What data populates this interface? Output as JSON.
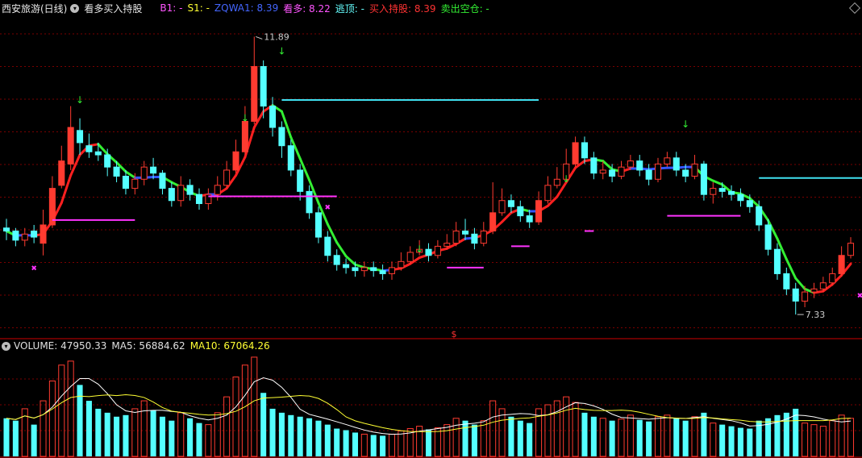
{
  "header": {
    "stock_name": "西安旅游(日线)",
    "indicator_name": "看多买入持股",
    "b1": "B1: -",
    "s1": "S1: -",
    "zqwa1": "ZQWA1: 8.39",
    "kanduo": "看多: 8.22",
    "taoding": "逃顶: -",
    "mairu": "买入持股: 8.39",
    "maichu": "卖出空仓: -"
  },
  "volume_header": {
    "volume": "VOLUME: 47950.33",
    "ma5": "MA5: 56884.62",
    "ma10": "MA10: 67064.26"
  },
  "annotations": {
    "high": "11.89",
    "low": "7.33",
    "marker": "$"
  },
  "colors": {
    "up": "#ff3b30",
    "down": "#54ffff",
    "ma_up": "#ff2020",
    "ma_down": "#33ee33",
    "ma_flat": "#3355ff",
    "magenta": "#ff33ff",
    "cyan": "#40e0f0",
    "grid": "#7a0000",
    "yellow": "#ffff33",
    "white": "#ffffff"
  },
  "chart_data": {
    "type": "candlestick",
    "ylim": [
      7.0,
      12.2
    ],
    "volume_ylim": [
      0,
      130000
    ],
    "candles": [
      [
        8.75,
        8.7,
        8.9,
        8.55,
        48000
      ],
      [
        8.7,
        8.55,
        8.75,
        8.45,
        45000
      ],
      [
        8.55,
        8.65,
        8.75,
        8.45,
        60000
      ],
      [
        8.7,
        8.6,
        8.8,
        8.5,
        40000
      ],
      [
        8.5,
        8.8,
        9.05,
        8.3,
        70000
      ],
      [
        8.8,
        9.4,
        9.6,
        8.75,
        95000
      ],
      [
        9.45,
        9.85,
        10.1,
        9.4,
        115000
      ],
      [
        9.8,
        10.4,
        10.75,
        9.7,
        120000
      ],
      [
        10.35,
        10.15,
        10.55,
        9.95,
        90000
      ],
      [
        10.1,
        10.0,
        10.3,
        9.9,
        70000
      ],
      [
        10.0,
        9.95,
        10.15,
        9.85,
        60000
      ],
      [
        9.95,
        9.75,
        10.05,
        9.6,
        55000
      ],
      [
        9.75,
        9.6,
        9.85,
        9.5,
        50000
      ],
      [
        9.6,
        9.4,
        9.7,
        9.3,
        52000
      ],
      [
        9.4,
        9.55,
        9.65,
        9.3,
        60000
      ],
      [
        9.55,
        9.75,
        9.85,
        9.45,
        70000
      ],
      [
        9.75,
        9.65,
        9.9,
        9.55,
        58000
      ],
      [
        9.65,
        9.4,
        9.7,
        9.3,
        50000
      ],
      [
        9.4,
        9.2,
        9.5,
        9.1,
        45000
      ],
      [
        9.2,
        9.45,
        9.6,
        9.1,
        55000
      ],
      [
        9.45,
        9.3,
        9.55,
        9.2,
        48000
      ],
      [
        9.3,
        9.15,
        9.4,
        9.05,
        42000
      ],
      [
        9.15,
        9.3,
        9.4,
        9.05,
        40000
      ],
      [
        9.3,
        9.45,
        9.6,
        9.2,
        55000
      ],
      [
        9.45,
        9.7,
        9.85,
        9.4,
        75000
      ],
      [
        9.7,
        10.0,
        10.2,
        9.65,
        100000
      ],
      [
        10.0,
        10.5,
        10.75,
        9.95,
        115000
      ],
      [
        10.5,
        11.4,
        11.89,
        10.45,
        125000
      ],
      [
        11.4,
        10.75,
        11.5,
        10.55,
        80000
      ],
      [
        10.75,
        10.4,
        10.9,
        10.25,
        60000
      ],
      [
        10.4,
        10.1,
        10.5,
        9.9,
        55000
      ],
      [
        10.1,
        9.7,
        10.2,
        9.6,
        52000
      ],
      [
        9.7,
        9.35,
        9.8,
        9.2,
        50000
      ],
      [
        9.35,
        9.0,
        9.45,
        8.9,
        48000
      ],
      [
        9.0,
        8.6,
        9.1,
        8.5,
        45000
      ],
      [
        8.6,
        8.3,
        8.7,
        8.2,
        40000
      ],
      [
        8.3,
        8.15,
        8.4,
        8.05,
        35000
      ],
      [
        8.15,
        8.1,
        8.25,
        8.0,
        33000
      ],
      [
        8.1,
        8.05,
        8.2,
        7.95,
        30000
      ],
      [
        8.05,
        8.1,
        8.2,
        7.95,
        28000
      ],
      [
        8.1,
        8.05,
        8.2,
        7.95,
        27000
      ],
      [
        8.05,
        8.0,
        8.15,
        7.9,
        26000
      ],
      [
        8.0,
        8.1,
        8.2,
        7.9,
        28000
      ],
      [
        8.1,
        8.2,
        8.35,
        8.05,
        32000
      ],
      [
        8.2,
        8.35,
        8.45,
        8.15,
        35000
      ],
      [
        8.35,
        8.4,
        8.55,
        8.3,
        38000
      ],
      [
        8.4,
        8.3,
        8.5,
        8.2,
        34000
      ],
      [
        8.3,
        8.45,
        8.55,
        8.25,
        36000
      ],
      [
        8.45,
        8.5,
        8.65,
        8.4,
        40000
      ],
      [
        8.5,
        8.7,
        8.85,
        8.45,
        48000
      ],
      [
        8.7,
        8.65,
        8.9,
        8.55,
        45000
      ],
      [
        8.65,
        8.5,
        8.75,
        8.4,
        40000
      ],
      [
        8.5,
        8.7,
        8.85,
        8.45,
        45000
      ],
      [
        8.7,
        9.0,
        9.5,
        8.65,
        70000
      ],
      [
        9.0,
        9.2,
        9.4,
        8.95,
        60000
      ],
      [
        9.2,
        9.1,
        9.3,
        9.0,
        50000
      ],
      [
        9.1,
        8.95,
        9.2,
        8.85,
        45000
      ],
      [
        8.95,
        8.85,
        9.05,
        8.75,
        42000
      ],
      [
        8.85,
        9.2,
        9.35,
        8.8,
        60000
      ],
      [
        9.2,
        9.45,
        9.6,
        9.15,
        65000
      ],
      [
        9.45,
        9.55,
        9.75,
        9.4,
        70000
      ],
      [
        9.55,
        9.8,
        10.05,
        9.5,
        75000
      ],
      [
        9.8,
        10.15,
        10.25,
        9.75,
        68000
      ],
      [
        10.15,
        9.9,
        10.25,
        9.8,
        55000
      ],
      [
        9.9,
        9.65,
        10.0,
        9.55,
        50000
      ],
      [
        9.65,
        9.7,
        9.85,
        9.55,
        48000
      ],
      [
        9.7,
        9.6,
        9.8,
        9.5,
        45000
      ],
      [
        9.6,
        9.75,
        9.85,
        9.55,
        47000
      ],
      [
        9.75,
        9.85,
        9.95,
        9.7,
        52000
      ],
      [
        9.85,
        9.7,
        9.95,
        9.6,
        46000
      ],
      [
        9.7,
        9.55,
        9.8,
        9.45,
        44000
      ],
      [
        9.55,
        9.8,
        9.9,
        9.5,
        50000
      ],
      [
        9.8,
        9.9,
        10.0,
        9.75,
        52000
      ],
      [
        9.9,
        9.7,
        10.0,
        9.6,
        48000
      ],
      [
        9.7,
        9.6,
        9.8,
        9.5,
        45000
      ],
      [
        9.6,
        9.8,
        9.95,
        9.55,
        50000
      ],
      [
        9.8,
        9.3,
        9.85,
        9.2,
        55000
      ],
      [
        9.3,
        9.4,
        9.5,
        9.15,
        42000
      ],
      [
        9.4,
        9.35,
        9.5,
        9.25,
        40000
      ],
      [
        9.35,
        9.3,
        9.45,
        9.2,
        38000
      ],
      [
        9.3,
        9.2,
        9.4,
        9.1,
        36000
      ],
      [
        9.2,
        9.1,
        9.3,
        9.0,
        35000
      ],
      [
        9.1,
        8.8,
        9.2,
        8.7,
        45000
      ],
      [
        8.8,
        8.4,
        8.9,
        8.3,
        48000
      ],
      [
        8.4,
        8.0,
        8.5,
        7.9,
        52000
      ],
      [
        8.0,
        7.75,
        8.1,
        7.65,
        55000
      ],
      [
        7.75,
        7.55,
        7.85,
        7.33,
        60000
      ],
      [
        7.55,
        7.7,
        7.8,
        7.45,
        42000
      ],
      [
        7.7,
        7.75,
        7.85,
        7.6,
        40000
      ],
      [
        7.75,
        7.85,
        7.95,
        7.7,
        38000
      ],
      [
        7.85,
        8.0,
        8.1,
        7.8,
        45000
      ],
      [
        8.0,
        8.3,
        8.45,
        7.95,
        52000
      ],
      [
        8.3,
        8.5,
        8.6,
        8.25,
        47950
      ]
    ]
  }
}
